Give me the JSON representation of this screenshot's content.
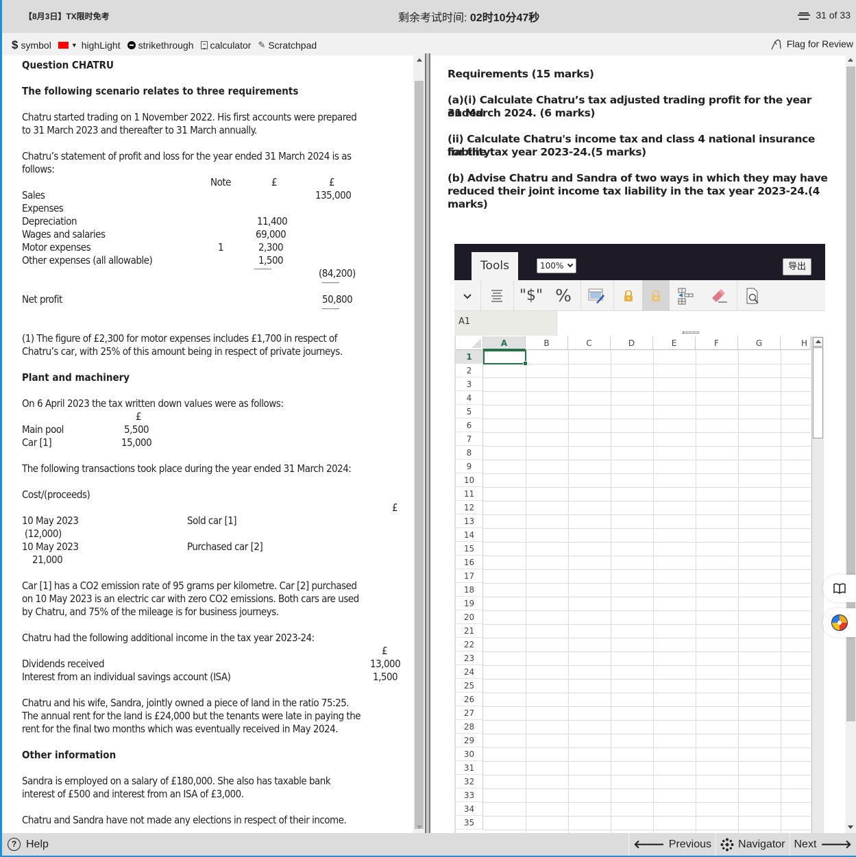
{
  "header": {
    "exam_name": "【8月3日】TX限时免考",
    "timer_label": "剩余考试时间: ",
    "timer_value": "02时10分47秒",
    "progress": "31 of 33"
  },
  "toolbar": {
    "symbol_label": "symbol",
    "highlight_label": "highLight",
    "highlight_color": "#ff0000",
    "strikethrough_label": "strikethrough",
    "calculator_label": "calculator",
    "scratchpad_label": "Scratchpad",
    "flag_label": "Flag for Review"
  },
  "question": {
    "title": "Question CHATRU",
    "scenario_heading": "The following scenario relates to three requirements",
    "intro_lines": [
      "Chatru started trading on 1 November 2022. His first accounts were prepared",
      "to 31 March 2023 and thereafter to 31 March annually."
    ],
    "pl_intro_lines": [
      "Chatru’s statement of profit and loss for the year ended 31 March 2024 is as",
      "follows:"
    ],
    "pl_table": {
      "headers": {
        "note": "Note",
        "col1": "£",
        "col2": "£"
      },
      "rows": [
        {
          "label": "Sales",
          "note": "",
          "col1": "",
          "col2": "135,000"
        },
        {
          "label": "Expenses",
          "note": "",
          "col1": "",
          "col2": ""
        },
        {
          "label": "Depreciation",
          "note": "",
          "col1": "11,400",
          "col2": ""
        },
        {
          "label": "Wages and salaries",
          "note": "",
          "col1": "69,000",
          "col2": ""
        },
        {
          "label": "Motor expenses",
          "note": "1",
          "col1": "2,300",
          "col2": ""
        },
        {
          "label": "Other expenses (all allowable)",
          "note": "",
          "col1": "1,500",
          "col2": ""
        }
      ],
      "total_expenses": "(84,200)",
      "rule": "————",
      "net_profit_label": "Net profit",
      "net_profit": "50,800"
    },
    "note_lines": [
      "(1) The figure of £2,300 for motor expenses includes £1,700 in respect of",
      "Chatru’s car, with 25% of this amount being in respect of private journeys."
    ],
    "pm_heading": "Plant and machinery",
    "twdv_intro": "On 6 April 2023 the tax written down values were as follows:",
    "twdv_table": {
      "currency": "£",
      "rows": [
        {
          "label": "Main pool",
          "value": "5,500"
        },
        {
          "label": "Car [1]",
          "value": "15,000"
        }
      ]
    },
    "transactions_intro": "The following transactions took place during the year ended 31 March 2024:",
    "cost_label": "Cost/(proceeds)",
    "transactions_currency": "£",
    "transactions": [
      {
        "date": "10 May 2023",
        "desc": "Sold car [1]",
        "amount": "(12,000)"
      },
      {
        "date": "10 May 2023",
        "desc": "Purchased car [2]",
        "amount": "21,000"
      }
    ],
    "car_lines": [
      "Car [1] has a CO2 emission rate of 95 grams per kilometre. Car [2] purchased",
      "on 10 May 2023 is an electric car with zero CO2 emissions. Both cars are used",
      "by Chatru, and 75% of the mileage is for business journeys."
    ],
    "income_intro": "Chatru had the following additional income in the tax year 2023-24:",
    "income_currency": "£",
    "income": [
      {
        "label": "Dividends received",
        "value": "13,000"
      },
      {
        "label": "Interest from an individual savings account (ISA)",
        "value": "1,500"
      }
    ],
    "land_lines": [
      "Chatru and his wife, Sandra, jointly owned a piece of land in the ratio 75:25.",
      "The annual rent for the land is £24,000 but the tenants were late in paying the",
      "rent for the final two months which was eventually received in May 2024."
    ],
    "other_heading": "Other information",
    "sandra_lines": [
      "Sandra is employed on a salary of £180,000. She also has taxable bank",
      "interest of £500 and interest from an ISA of £3,000."
    ],
    "elections_line": "Chatru and Sandra have not made any elections in respect of their income."
  },
  "requirements": {
    "heading": "Requirements (15 marks)",
    "a_i": [
      "(a)(i) Calculate Chatru’s tax adjusted trading profit for the year ended",
      "31 March 2024. (6 marks)"
    ],
    "a_ii": [
      "(ii) Calculate Chatru's income tax and class 4 national insurance liability",
      "for the tax year 2023-24.(5 marks)"
    ],
    "b": [
      "(b) Advise Chatru and Sandra of two ways in which they may have",
      "reduced their joint income tax liability in the tax year 2023-24.(4",
      "marks)"
    ]
  },
  "spreadsheet": {
    "tab_label": "Tools",
    "zoom_value": "100%",
    "export_label": "导出",
    "ribbon_icons": [
      "collapse-chevron-icon",
      "align-icon",
      "currency-format-icon",
      "percent-format-icon",
      "format-painter-icon",
      "lock-icon",
      "unlock-icon",
      "insert-cells-icon",
      "eraser-icon",
      "print-preview-icon"
    ],
    "currency_glyph": "\"$\"",
    "percent_glyph": "%",
    "name_box": "A1",
    "formula": "",
    "columns": [
      "A",
      "B",
      "C",
      "D",
      "E",
      "F",
      "G",
      "H"
    ],
    "rows": [
      "1",
      "2",
      "3",
      "4",
      "5",
      "6",
      "7",
      "8",
      "9",
      "10",
      "11",
      "12",
      "13",
      "14",
      "15",
      "16",
      "17",
      "18",
      "19",
      "20",
      "21",
      "22",
      "23",
      "24",
      "25",
      "26",
      "27",
      "28",
      "29",
      "30",
      "31",
      "32",
      "33",
      "34",
      "35"
    ],
    "selected_cell": "A1",
    "accent_color": "#217346"
  },
  "footer": {
    "help_label": "Help",
    "previous_label": "Previous",
    "navigator_label": "Navigator",
    "next_label": "Next"
  }
}
